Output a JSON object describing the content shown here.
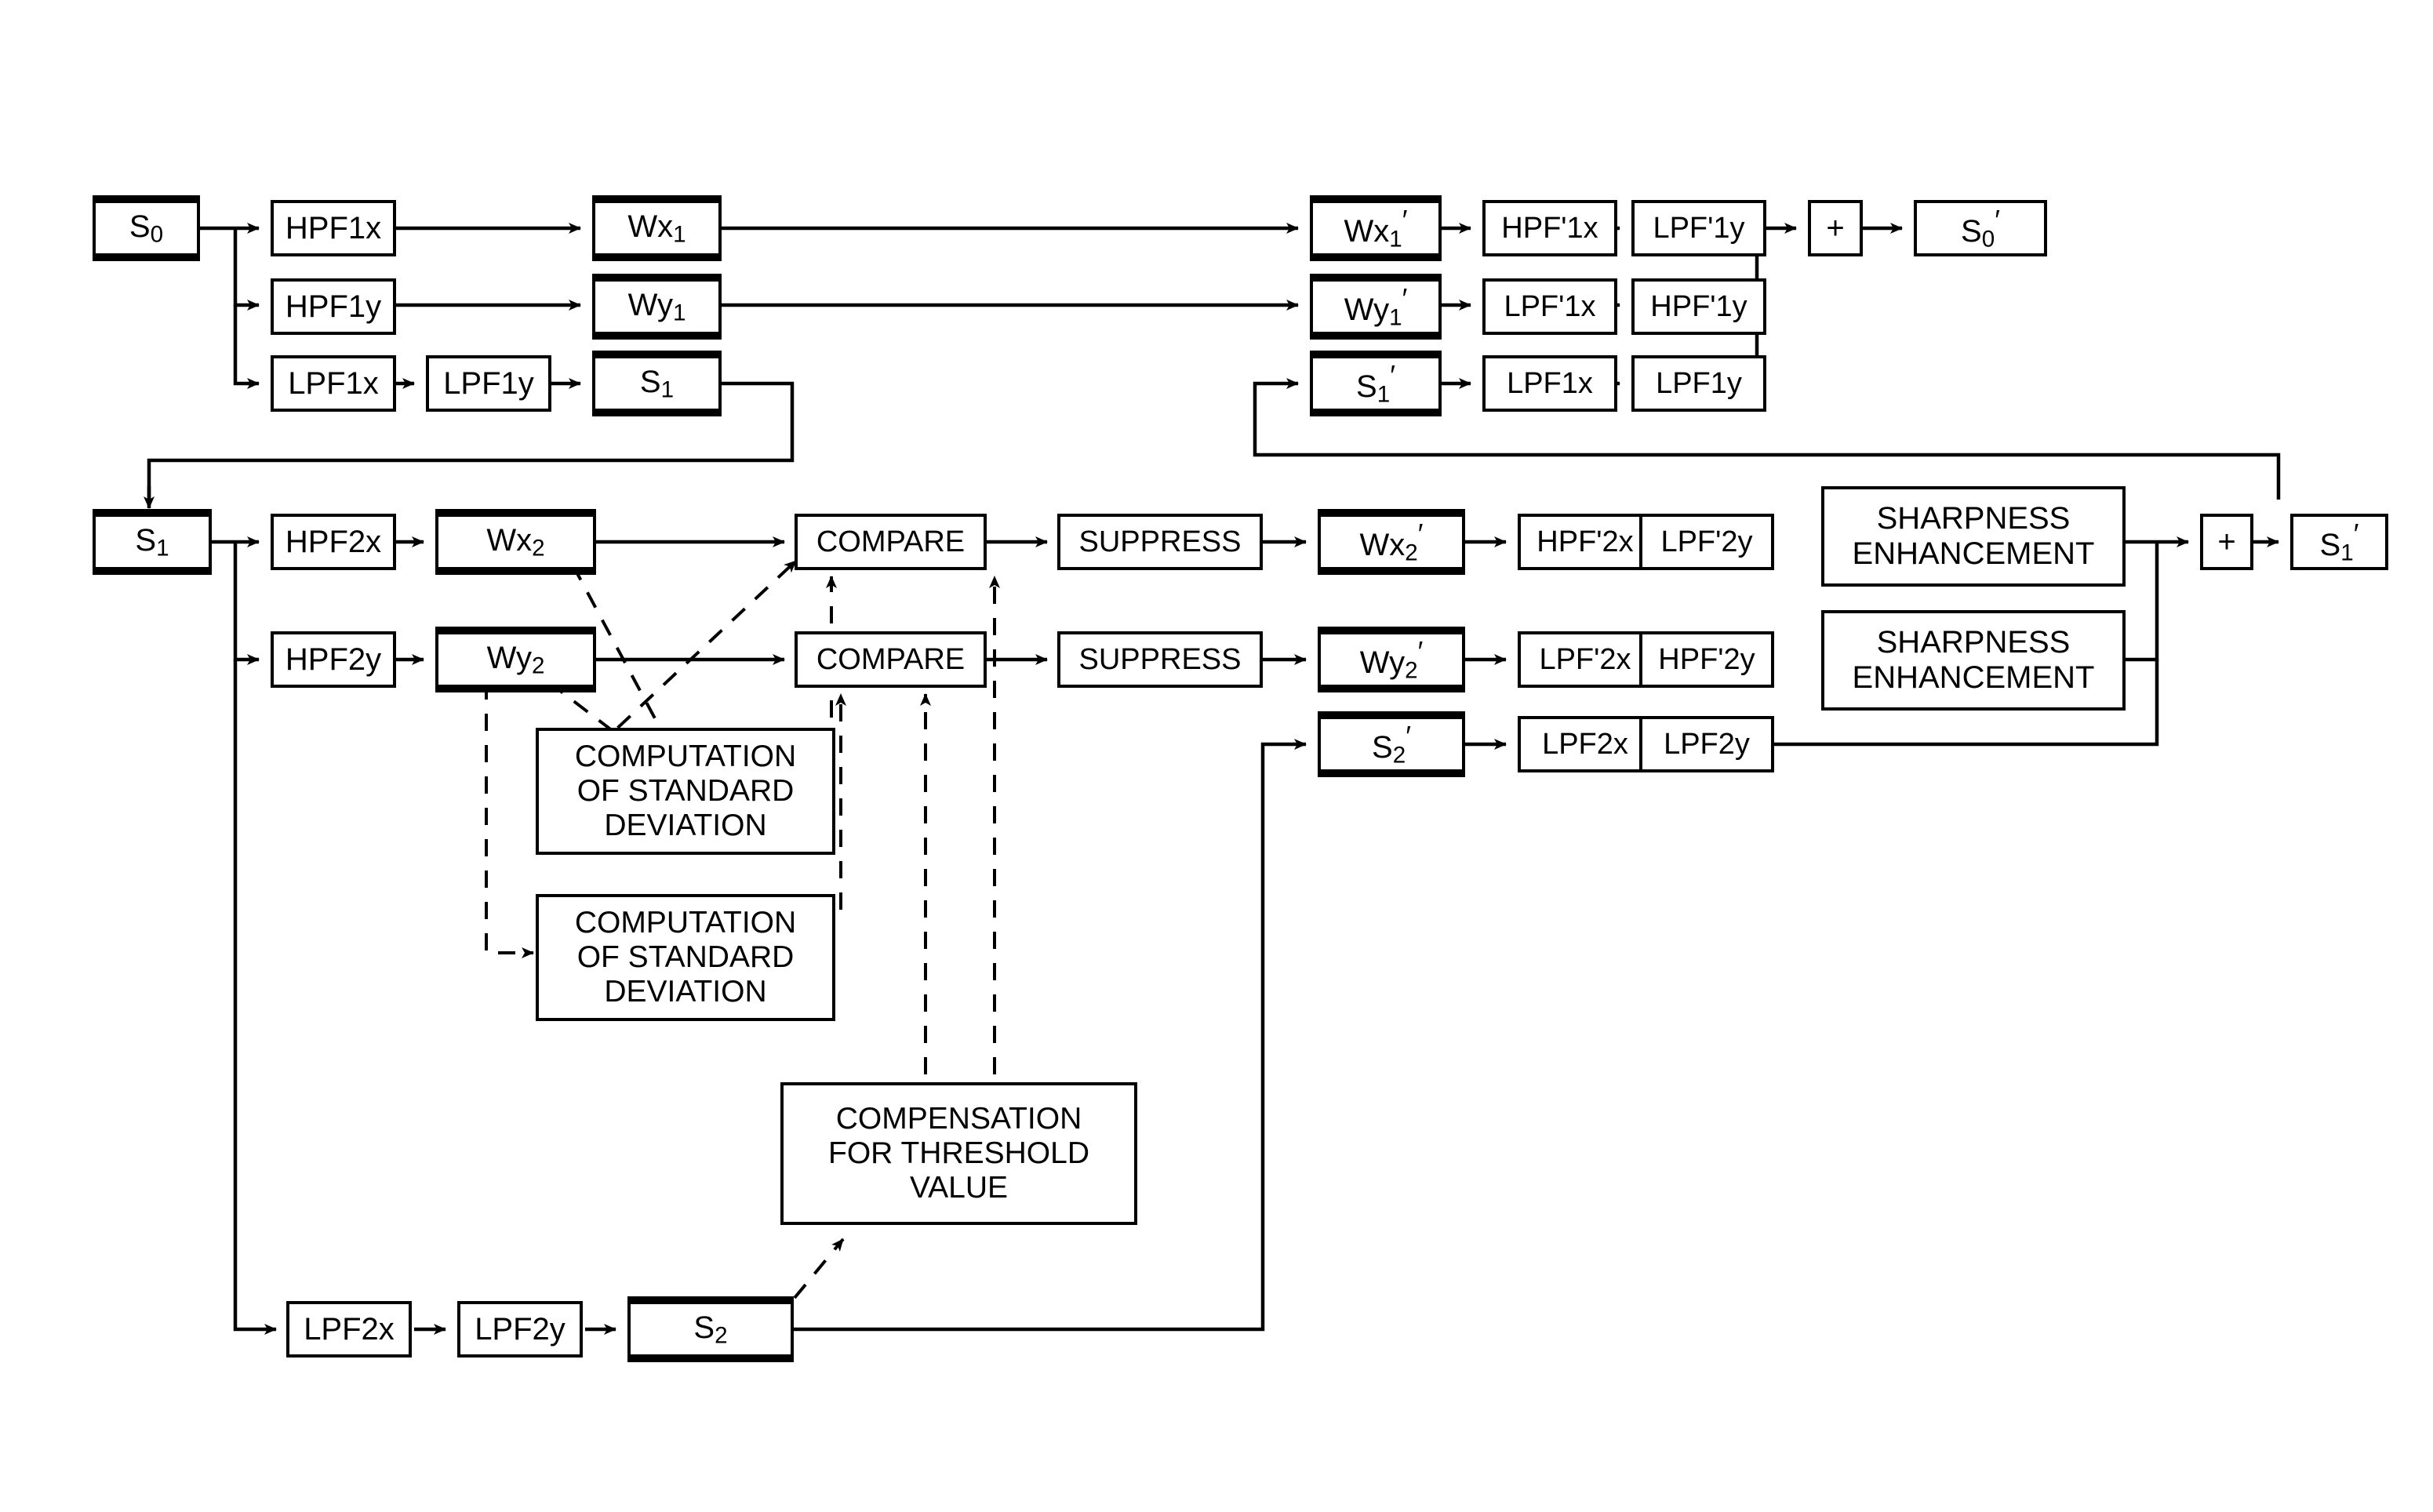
{
  "diagram": {
    "type": "signal-processing-block-diagram",
    "title": "",
    "line_color": "#000000",
    "background": "#ffffff",
    "stage1": {
      "input": "S0",
      "branches": [
        {
          "filters": [
            "HPF1x"
          ],
          "coef": "Wx1"
        },
        {
          "filters": [
            "HPF1y"
          ],
          "coef": "Wy1"
        },
        {
          "filters": [
            "LPF1x",
            "LPF1y"
          ],
          "coef": "S1"
        }
      ],
      "reconstruction": [
        {
          "coef": "Wx1'",
          "filters": [
            "HPF'1x",
            "LPF'1y"
          ]
        },
        {
          "coef": "Wy1'",
          "filters": [
            "LPF'1x",
            "HPF'1y"
          ]
        },
        {
          "coef": "S1'",
          "filters": [
            "LPF1x",
            "LPF1y"
          ]
        }
      ],
      "adder": "+",
      "output": "S0'"
    },
    "stage2": {
      "input": "S1",
      "branches": [
        {
          "filters": [
            "HPF2x"
          ],
          "coef": "Wx2"
        },
        {
          "filters": [
            "HPF2y"
          ],
          "coef": "Wy2"
        },
        {
          "filters": [
            "LPF2x",
            "LPF2y"
          ],
          "coef": "S2"
        }
      ],
      "compare_x": "COMPARE",
      "compare_y": "COMPARE",
      "suppress_x": "SUPPRESS",
      "suppress_y": "SUPPRESS",
      "stddev_1": "COMPUTATION\nOF STANDARD\nDEVIATION",
      "stddev_2": "COMPUTATION\nOF STANDARD\nDEVIATION",
      "threshold": "COMPENSATION\nFOR THRESHOLD\nVALUE",
      "reconstruction": [
        {
          "coef": "Wx2'",
          "filters": [
            "HPF'2x",
            "LPF'2y"
          ],
          "enhance": "SHARPNESS\nENHANCEMENT"
        },
        {
          "coef": "Wy2'",
          "filters": [
            "LPF'2x",
            "HPF'2y"
          ],
          "enhance": "SHARPNESS\nENHANCEMENT"
        },
        {
          "coef": "S2'",
          "filters": [
            "LPF2x",
            "LPF2y"
          ],
          "enhance": ""
        }
      ],
      "adder": "+",
      "output": "S1'"
    },
    "labels": {
      "S0": "S0",
      "S0p": "S0'",
      "S1": "S1",
      "S1p": "S1'",
      "S2": "S2",
      "S2p": "S2'",
      "HPF1x": "HPF1x",
      "HPF1y": "HPF1y",
      "LPF1x": "LPF1x",
      "LPF1y": "LPF1y",
      "Wx1": "Wx1",
      "Wy1": "Wy1",
      "Wx1p": "Wx1'",
      "Wy1p": "Wy1'",
      "HPFp1x": "HPF'1x",
      "LPFp1y": "LPF'1y",
      "LPFp1x": "LPF'1x",
      "HPFp1y": "HPF'1y",
      "HPF2x": "HPF2x",
      "HPF2y": "HPF2y",
      "LPF2x": "LPF2x",
      "LPF2y": "LPF2y",
      "Wx2": "Wx2",
      "Wy2": "Wy2",
      "Wx2p": "Wx2'",
      "Wy2p": "Wy2'",
      "HPFp2x": "HPF'2x",
      "LPFp2y": "LPF'2y",
      "LPFp2x": "LPF'2x",
      "HPFp2y": "HPF'2y",
      "COMPARE": "COMPARE",
      "SUPPRESS": "SUPPRESS",
      "STDDEV": "COMPUTATION\nOF STANDARD\nDEVIATION",
      "THRESH": "COMPENSATION\nFOR THRESHOLD\nVALUE",
      "SHARP": "SHARPNESS\nENHANCEMENT",
      "PLUS": "+"
    }
  }
}
